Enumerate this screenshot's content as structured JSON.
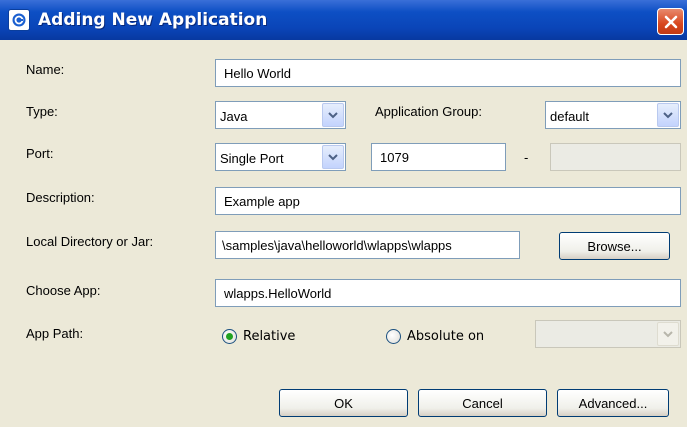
{
  "window": {
    "title": "Adding New Application",
    "icon": "app-icon",
    "close_icon": "close-icon"
  },
  "form": {
    "name_label": "Name:",
    "name_value": "Hello World",
    "type_label": "Type:",
    "type_value": "Java",
    "app_group_label": "Application Group:",
    "app_group_value": "default",
    "port_label": "Port:",
    "port_mode_value": "Single Port",
    "port_value": "1079",
    "port_separator": "-",
    "port_end_value": "",
    "description_label": "Description:",
    "description_value": "Example app",
    "local_dir_label": "Local Directory or Jar:",
    "local_dir_value": "\\samples\\java\\helloworld\\wlapps\\wlapps",
    "browse_label": "Browse...",
    "choose_app_label": "Choose App:",
    "choose_app_value": "wlapps.HelloWorld",
    "app_path_label": "App Path:",
    "relative_label": "Relative",
    "absolute_label": "Absolute on",
    "selected_path": "Relative",
    "absolute_host_value": ""
  },
  "footer": {
    "ok_label": "OK",
    "cancel_label": "Cancel",
    "advanced_label": "Advanced..."
  },
  "colors": {
    "titlebar": "#0a45b8",
    "window_bg": "#ece9d8",
    "close": "#d8471f",
    "radio_dot": "#21a121"
  }
}
